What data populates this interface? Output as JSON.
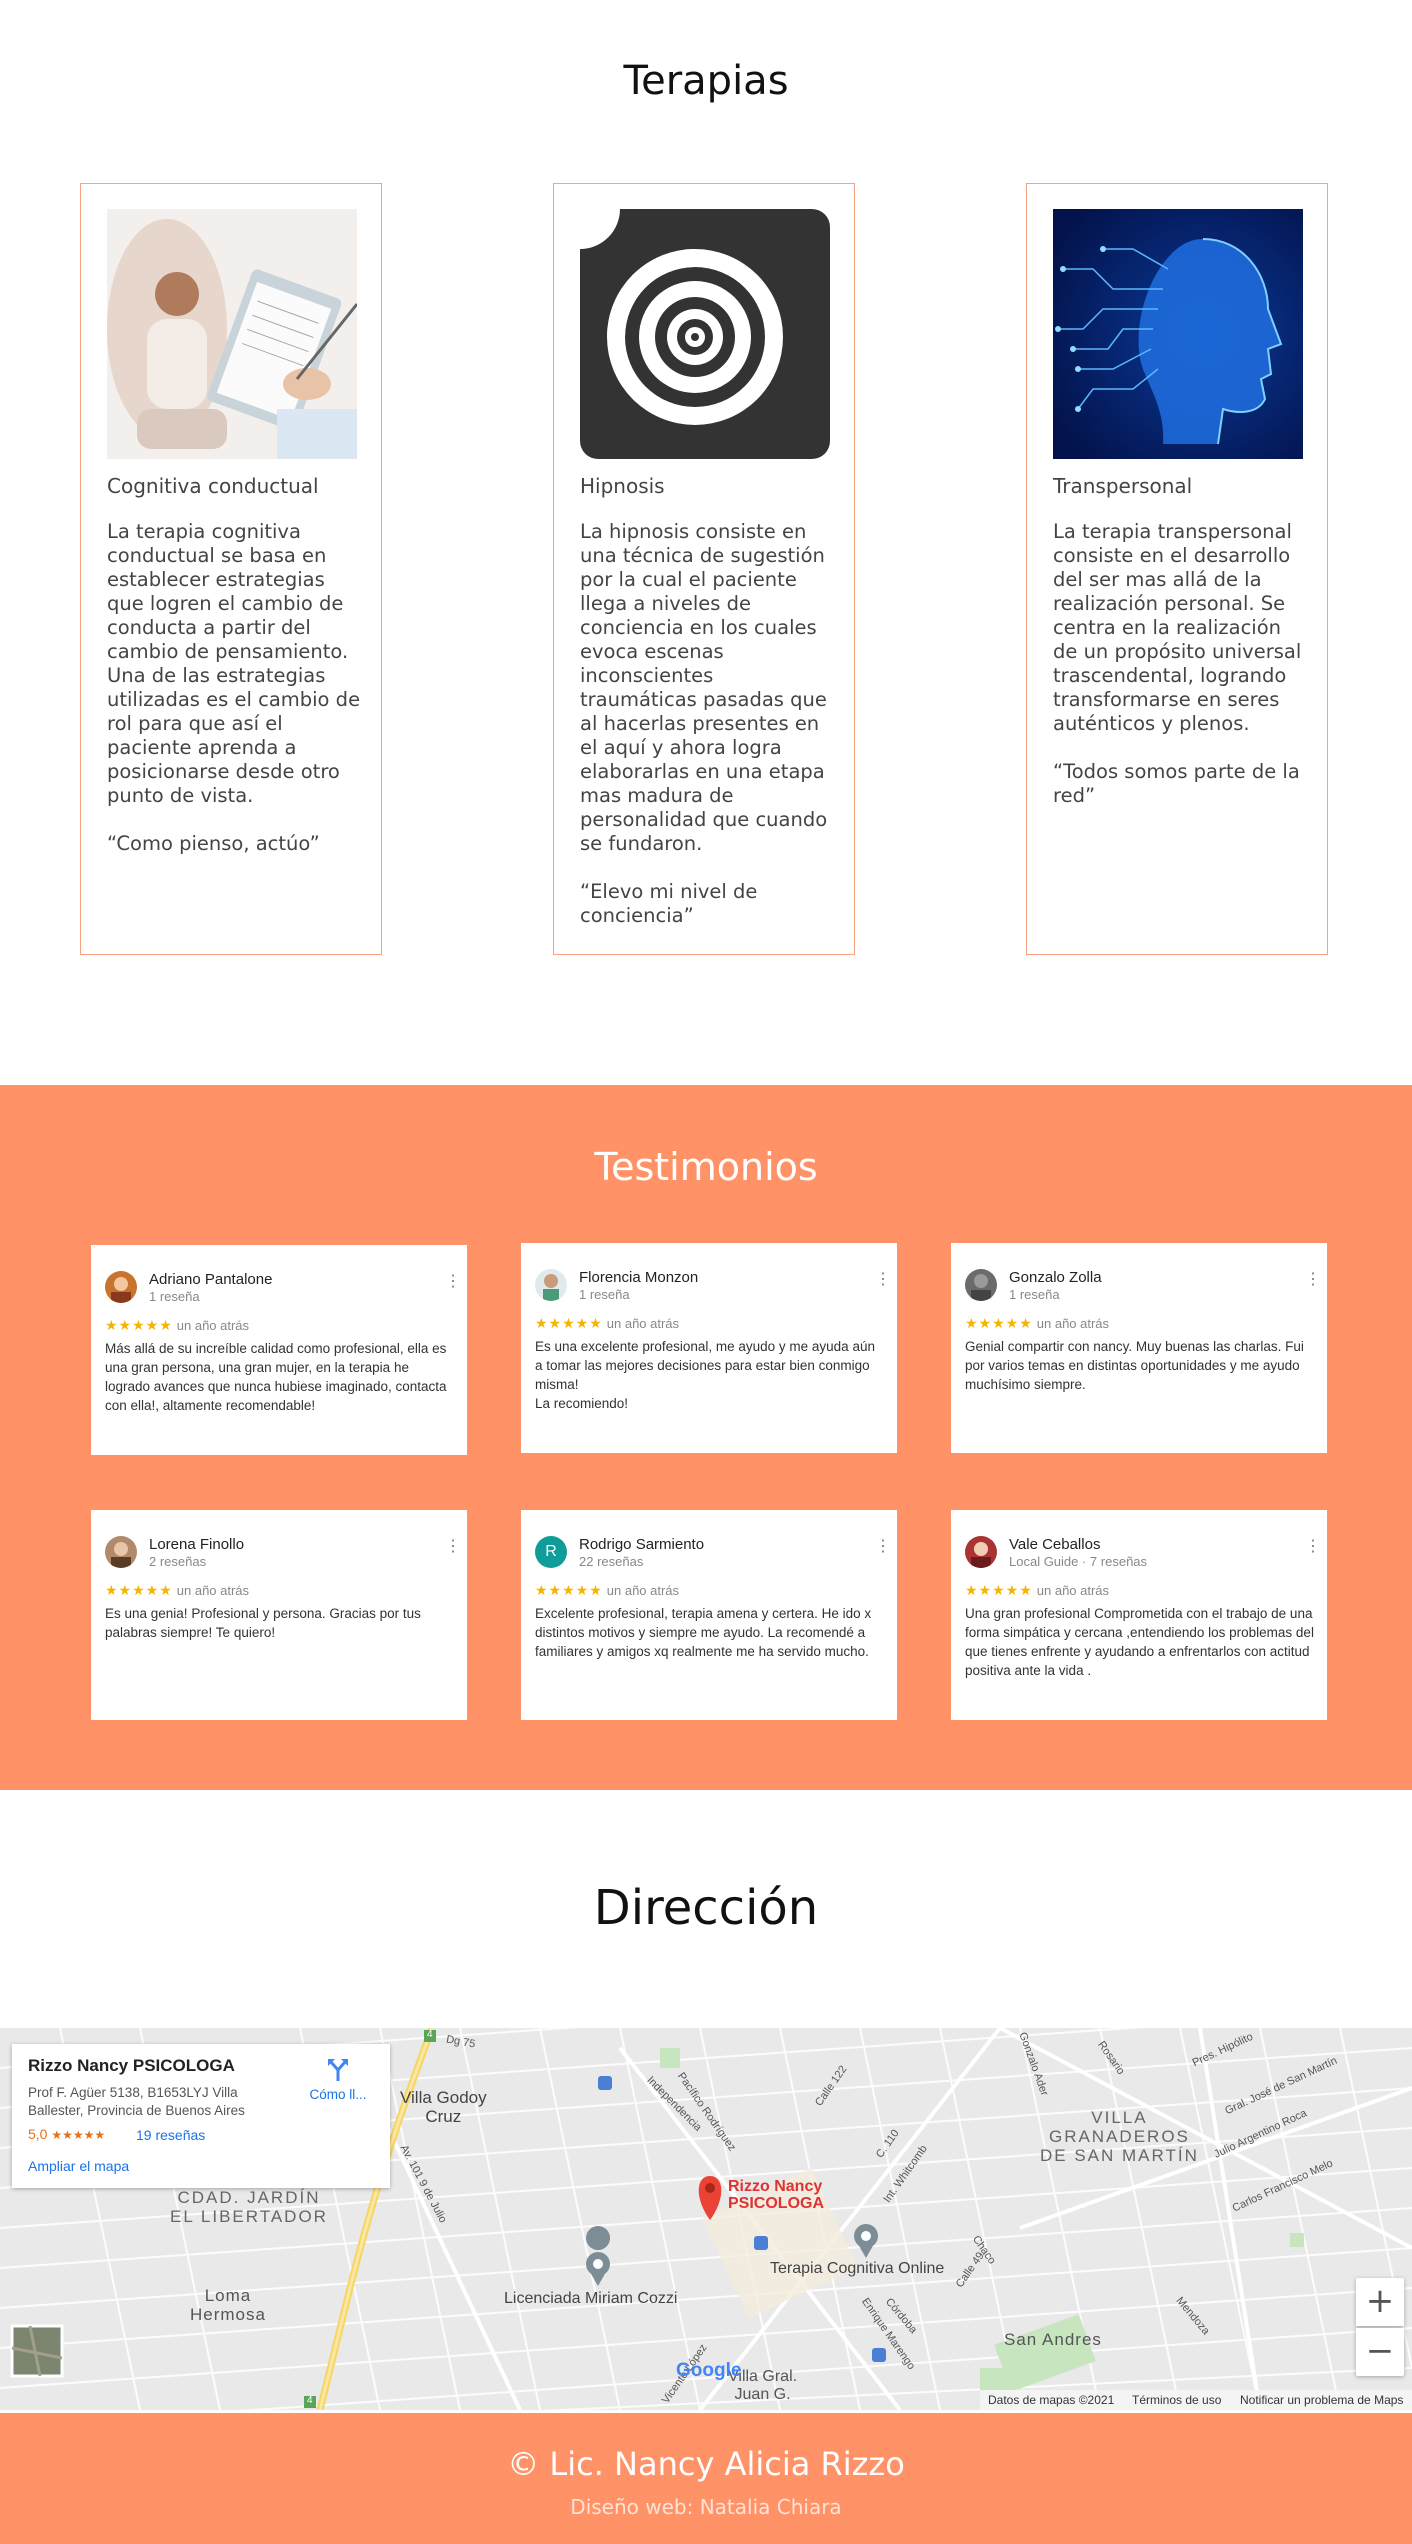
{
  "terapias": {
    "title": "Terapias",
    "cards": [
      {
        "name": "Cognitiva conductual",
        "description": "La terapia cognitiva conductual se basa en establecer estrategias que logren el cambio de conducta a partir del cambio de pensamiento. Una de las estrategias utilizadas es el cambio de rol para que así el paciente aprenda a posicionarse desde otro punto de vista.\n\n“Como pienso, actúo”"
      },
      {
        "name": "Hipnosis",
        "description": "La hipnosis consiste en una técnica de sugestión por la cual el paciente llega a niveles de conciencia en los cuales evoca escenas inconscientes traumáticas pasadas que al hacerlas presentes en el aquí y ahora logra elaborarlas en una etapa mas madura de personalidad que cuando se fundaron.\n\n“Elevo mi nivel de conciencia”"
      },
      {
        "name": "Transpersonal",
        "description": "La terapia transpersonal consiste en el desarrollo del ser mas allá de la realización personal. Se centra en la realización de un propósito universal trascendental, logrando transformarse en seres auténticos y plenos.\n\n“Todos somos parte de la red”"
      }
    ]
  },
  "testimonios": {
    "title": "Testimonios",
    "reviews": [
      {
        "name": "Adriano Pantalone",
        "meta": "1 reseña",
        "stars": "★★★★★",
        "when": "un año atrás",
        "text": "Más allá de su increíble calidad como profesional, ella es una gran persona, una gran mujer, en la terapia he logrado avances que nunca hubiese imaginado, contacta con ella!, altamente recomendable!"
      },
      {
        "name": "Florencia Monzon",
        "meta": "1 reseña",
        "stars": "★★★★★",
        "when": "un año atrás",
        "text": "Es una excelente profesional, me ayudo y me ayuda aún a tomar las mejores decisiones para estar bien conmigo misma!\nLa recomiendo!"
      },
      {
        "name": "Gonzalo Zolla",
        "meta": "1 reseña",
        "stars": "★★★★★",
        "when": "un año atrás",
        "text": "Genial compartir con nancy. Muy buenas las charlas. Fui por varios temas en distintas oportunidades y me ayudo muchísimo siempre."
      },
      {
        "name": "Lorena Finollo",
        "meta": "2 reseñas",
        "stars": "★★★★★",
        "when": "un año atrás",
        "text": "Es una genia! Profesional y persona. Gracias por tus palabras siempre! Te quiero!"
      },
      {
        "name": "Rodrigo Sarmiento",
        "meta": "22 reseñas",
        "stars": "★★★★★",
        "when": "un año atrás",
        "initial": "R",
        "text": "Excelente profesional, terapia amena y certera. He ido x distintos motivos y siempre me ayudo. La recomendé a familiares y amigos xq realmente me ha servido mucho."
      },
      {
        "name": "Vale Ceballos",
        "meta": "Local Guide · 7 reseñas",
        "stars": "★★★★★",
        "when": "un año atrás",
        "text": "Una gran profesional Comprometida  con el trabajo de una forma simpática y cercana ,entendiendo los problemas del que tienes enfrente y ayudando a enfrentarlos con actitud positiva ante la vida ."
      }
    ]
  },
  "direccion": {
    "title": "Dirección",
    "map": {
      "place_name": "Rizzo Nancy PSICOLOGA",
      "address": "Prof F. Agüer 5138, B1653LYJ Villa Ballester, Provincia de Buenos Aires",
      "rating": "5,0",
      "rating_stars": "★★★★★",
      "reviews_link": "19 reseñas",
      "directions_label": "Cómo ll...",
      "enlarge_link": "Ampliar el mapa",
      "marker_label": "Rizzo Nancy\nPSICOLOGA",
      "places": {
        "villa_godoy_cruz": "Villa Godoy\nCruz",
        "granaderos": "VILLA\nGRANADEROS\nDE SAN MARTÍN",
        "jardin": "CDAD. JARDÍN\nEL LIBERTADOR",
        "loma_hermosa": "Loma\nHermosa",
        "miriam_cozzi": "Licenciada Miriam Cozzi",
        "terapia_online": "Terapia Cognitiva Online",
        "san_andres": "San Andres",
        "villa_gral": "Villa Gral.\nJuan G."
      },
      "streets": {
        "pacifico": "Pacífico Rodríguez",
        "independencia": "Independencia",
        "calle122": "Calle 122",
        "c110": "C. 110",
        "whitcomb": "Int. Whitcomb",
        "av101": "Av. 101 9 de Julio",
        "vicente_lopez": "Vicente López",
        "cordoba": "Córdoba",
        "marengo": "Enrique Marengo",
        "calle49": "Calle 49",
        "chaco": "Chaco",
        "mendoza": "Mendoza",
        "rosario": "Rosario",
        "pres_hipolito": "Pres. Hipólito",
        "jose_martin": "Gral. José de San Martín",
        "julio_roca": "Julio Argentino Roca",
        "carlos_melo": "Carlos Francisco Melo",
        "dg75": "Dg 75",
        "gonzalo_ader": "Gonzalo Ader"
      },
      "route_shields": [
        "4",
        "4"
      ],
      "attribution": "Datos de mapas ©2021",
      "terms": "Términos de uso",
      "report": "Notificar un problema de Maps",
      "google_logo": "Google",
      "zoom_in": "+",
      "zoom_out": "−"
    }
  },
  "footer": {
    "copyright": "© Lic. Nancy Alicia Rizzo",
    "credit": "Diseño web: Natalia Chiara"
  },
  "colors": {
    "accent": "#ff9267",
    "card_border": "#f7a27f",
    "star": "#f5b400",
    "link": "#1a73e8",
    "marker": "#ea4335"
  }
}
